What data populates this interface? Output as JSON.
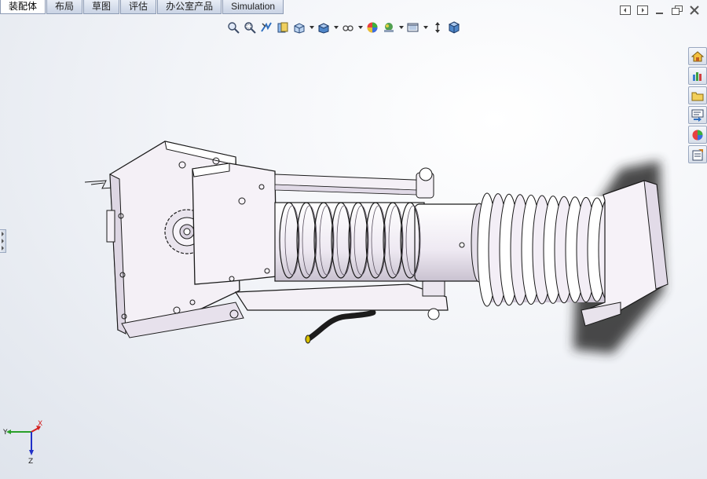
{
  "tabs": [
    {
      "label": "装配体",
      "active": true
    },
    {
      "label": "布局",
      "active": false
    },
    {
      "label": "草图",
      "active": false
    },
    {
      "label": "评估",
      "active": false
    },
    {
      "label": "办公室产品",
      "active": false
    },
    {
      "label": "Simulation",
      "active": false
    }
  ],
  "hud_toolbar": {
    "buttons": [
      "zoom-to-fit-icon",
      "zoom-to-area-icon",
      "previous-view-icon",
      "section-view-icon",
      "view-orientation-icon",
      "display-style-icon",
      "hide-show-items-icon",
      "edit-appearance-icon",
      "apply-scene-icon",
      "view-settings-icon",
      "rotate-view-icon",
      "3d-view-icon"
    ]
  },
  "window_controls": [
    "tile-left-icon",
    "tile-right-icon",
    "minimize-icon",
    "restore-icon",
    "close-icon"
  ],
  "task_pane": [
    "solidworks-resources-icon",
    "design-library-icon",
    "file-explorer-icon",
    "view-palette-icon",
    "appearances-scenes-icon",
    "custom-properties-icon"
  ],
  "triad": {
    "axes": [
      "Y",
      "X",
      "Z"
    ],
    "colors": {
      "x": "#d42020",
      "y": "#2aa02a",
      "z": "#2030c8"
    }
  },
  "colors": {
    "model_face": "#f4f0f6",
    "model_edge": "#1a1a1a",
    "accent_shadow": "#2a2a2a"
  }
}
